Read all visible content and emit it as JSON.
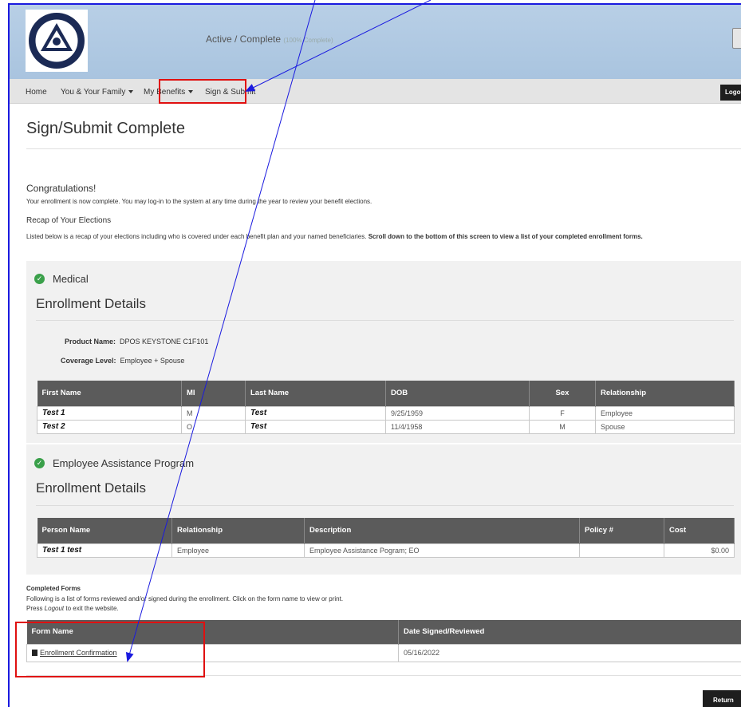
{
  "header": {
    "status": "Active / Complete",
    "status_pct": "(100% Complete)",
    "logo": {
      "top_text": "POTTSTOWN SCHOOL DISTRICT",
      "bottom_text": "POTTSTOWN, PENNSYLVANIA"
    }
  },
  "nav": {
    "home": "Home",
    "family": "You & Your Family",
    "benefits": "My Benefits",
    "sign": "Sign & Submit",
    "logout": "Logo"
  },
  "page": {
    "title": "Sign/Submit Complete",
    "congrats": "Congratulations!",
    "congrats_text": "Your enrollment is now complete. You may log-in to the system at any time during the year to review your benefit elections.",
    "recap_heading": "Recap of Your Elections",
    "recap_text_plain": "Listed below is a recap of your elections including who is covered under each benefit plan and your named beneficiaries. ",
    "recap_text_bold": "Scroll down to the bottom of this screen to view a list of your completed enrollment forms."
  },
  "medical": {
    "plan": "Medical",
    "heading": "Enrollment Details",
    "product_label": "Product Name:",
    "product_value": "DPOS KEYSTONE C1F101",
    "coverage_label": "Coverage Level:",
    "coverage_value": "Employee + Spouse",
    "columns": [
      "First Name",
      "MI",
      "Last Name",
      "DOB",
      "Sex",
      "Relationship"
    ],
    "rows": [
      [
        "Test 1",
        "M",
        "Test",
        "9/25/1959",
        "F",
        "Employee"
      ],
      [
        "Test 2",
        "O",
        "Test",
        "11/4/1958",
        "M",
        "Spouse"
      ]
    ]
  },
  "eap": {
    "plan": "Employee Assistance Program",
    "heading": "Enrollment Details",
    "columns": [
      "Person Name",
      "Relationship",
      "Description",
      "Policy #",
      "Cost"
    ],
    "row": [
      "Test 1 test",
      "Employee",
      "Employee Assistance Pogram; EO",
      "",
      "$0.00"
    ]
  },
  "forms": {
    "heading": "Completed Forms",
    "text1": "Following is a list of forms reviewed and/or signed during the enrollment. Click on the form name to view or print.",
    "text2_pre": "Press ",
    "text2_em": "Logout",
    "text2_post": " to exit the website.",
    "col_name": "Form Name",
    "col_date": "Date Signed/Reviewed",
    "form_name": "Enrollment Confirmation",
    "form_date": "05/16/2022"
  },
  "buttons": {
    "return": "Return"
  },
  "colors": {
    "annotation_blue": "#1a1adf",
    "annotation_red": "#e01010",
    "check_green": "#3aa04a",
    "table_header": "#5b5b5b"
  }
}
